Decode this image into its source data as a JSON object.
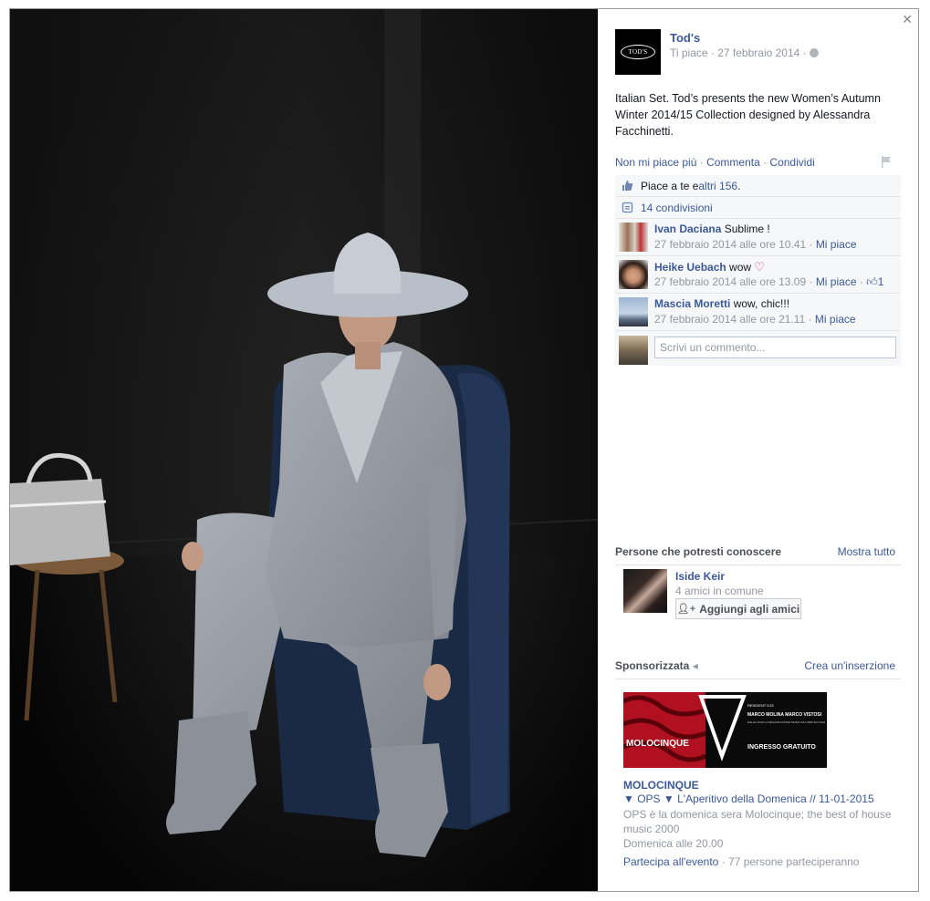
{
  "photo": {
    "alt": ""
  },
  "post": {
    "page_name": "Tod's",
    "logo_text": "TOD'S",
    "meta": "Ti piace · 27 febbraio 2014 · ",
    "caption": "Italian Set. Tod’s presents the new Women’s Autumn Winter 2014/15 Collection designed by Alessandra Facchinetti.",
    "actions": {
      "unlike": "Non mi piace più",
      "comment": "Commenta",
      "share": "Condividi",
      "separator": " · "
    },
    "likes": {
      "prefix": "Piace a te e ",
      "others_link": "altri 156",
      "suffix": "."
    },
    "shares": "14 condivisioni",
    "comments": [
      {
        "author": "Ivan Daciana",
        "text": " Sublime !",
        "timestamp": "27 febbraio 2014 alle ore 10.41",
        "like_link": "Mi piace",
        "like_count": ""
      },
      {
        "author": "Heike Uebach",
        "text": " wow ",
        "timestamp": "27 febbraio 2014 alle ore 13.09",
        "like_link": "Mi piace",
        "like_count": "1"
      },
      {
        "author": "Mascia Moretti",
        "text": " wow, chic!!!",
        "timestamp": "27 febbraio 2014 alle ore 21.11",
        "like_link": "Mi piace",
        "like_count": ""
      }
    ],
    "comment_placeholder": "Scrivi un commento..."
  },
  "people": {
    "header": "Persone che potresti conoscere",
    "see_all": "Mostra tutto",
    "person": {
      "name": "Iside Keir",
      "mutual": "4 amici in comune",
      "add_button": "Aggiungi agli amici"
    }
  },
  "sponsored": {
    "header": "Sponsorizzata",
    "create_ad": "Crea un'inserzione",
    "ad": {
      "image_text_brand": "MOLOCINQUE",
      "image_text_resident": "RESIDENT DJS",
      "image_text_djs": "MARCO MOLINA  MARCO VISTOSI",
      "image_text_details": "DALLE 20.00 LA MIGLIOR HOUSE MUSIC DAL 2000 AD OGGI",
      "image_text_free": "INGRESSO GRATUITO",
      "title": "MOLOCINQUE",
      "event": "▼ OPS ▼ L'Aperitivo della Domenica // 11-01-2015",
      "description": "OPS è la domenica sera Molocinque; the best of house music 2000",
      "when": "Domenica alle 20.00",
      "join_link": "Partecipa all'evento",
      "attending": " · 77 persone parteciperanno"
    }
  },
  "colors": {
    "link": "#3b5998",
    "muted": "#9197a3",
    "ufi_bg": "#f6f7f9"
  }
}
